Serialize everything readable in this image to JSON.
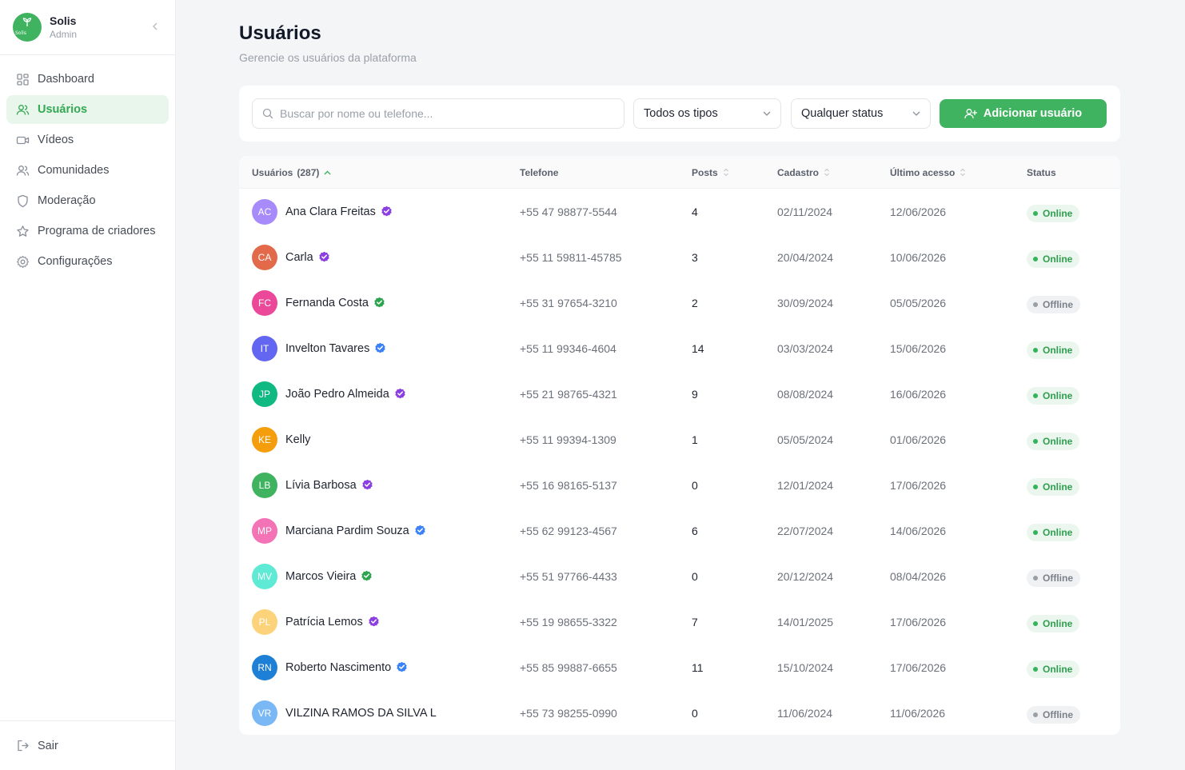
{
  "brand": {
    "name": "Solis",
    "role": "Admin",
    "logo_text": "Solis"
  },
  "nav": [
    {
      "label": "Dashboard",
      "icon": "dashboard-icon",
      "active": false
    },
    {
      "label": "Usuários",
      "icon": "users-icon",
      "active": true
    },
    {
      "label": "Vídeos",
      "icon": "video-icon",
      "active": false
    },
    {
      "label": "Comunidades",
      "icon": "communities-icon",
      "active": false
    },
    {
      "label": "Moderação",
      "icon": "shield-icon",
      "active": false
    },
    {
      "label": "Programa de criadores",
      "icon": "star-icon",
      "active": false
    },
    {
      "label": "Configurações",
      "icon": "gear-icon",
      "active": false
    }
  ],
  "logout": {
    "label": "Sair",
    "icon": "logout-icon"
  },
  "page": {
    "title": "Usuários",
    "subtitle": "Gerencie os usuários da plataforma"
  },
  "toolbar": {
    "search_placeholder": "Buscar por nome ou telefone...",
    "type_filter": "Todos os tipos",
    "status_filter": "Qualquer status",
    "add_label": "Adicionar usuário"
  },
  "table": {
    "headers": {
      "users": "Usuários",
      "users_count": "(287)",
      "phone": "Telefone",
      "posts": "Posts",
      "signup": "Cadastro",
      "last_access": "Último acesso",
      "status": "Status"
    },
    "rows": [
      {
        "initials": "AC",
        "name": "Ana Clara Freitas",
        "color": "#a78bfa",
        "verified": "purple",
        "phone": "+55 47 98877-5544",
        "posts": "4",
        "signup": "02/11/2024",
        "last": "12/06/2026",
        "status": "Online"
      },
      {
        "initials": "CA",
        "name": "Carla",
        "color": "#e2694a",
        "verified": "purple",
        "phone": "+55 11 59811-45785",
        "posts": "3",
        "signup": "20/04/2024",
        "last": "10/06/2026",
        "status": "Online"
      },
      {
        "initials": "FC",
        "name": "Fernanda Costa",
        "color": "#ec4899",
        "verified": "green",
        "phone": "+55 31 97654-3210",
        "posts": "2",
        "signup": "30/09/2024",
        "last": "05/05/2026",
        "status": "Offline"
      },
      {
        "initials": "IT",
        "name": "Invelton Tavares",
        "color": "#6366f1",
        "verified": "blue",
        "phone": "+55 11 99346-4604",
        "posts": "14",
        "signup": "03/03/2024",
        "last": "15/06/2026",
        "status": "Online"
      },
      {
        "initials": "JP",
        "name": "João Pedro Almeida",
        "color": "#10b981",
        "verified": "purple",
        "phone": "+55 21 98765-4321",
        "posts": "9",
        "signup": "08/08/2024",
        "last": "16/06/2026",
        "status": "Online"
      },
      {
        "initials": "KE",
        "name": "Kelly",
        "color": "#f59e0b",
        "verified": "",
        "phone": "+55 11 99394-1309",
        "posts": "1",
        "signup": "05/05/2024",
        "last": "01/06/2026",
        "status": "Online"
      },
      {
        "initials": "LB",
        "name": "Lívia Barbosa",
        "color": "#3fb35f",
        "verified": "purple",
        "phone": "+55 16 98165-5137",
        "posts": "0",
        "signup": "12/01/2024",
        "last": "17/06/2026",
        "status": "Online"
      },
      {
        "initials": "MP",
        "name": "Marciana Pardim Souza",
        "color": "#f472b6",
        "verified": "blue",
        "phone": "+55 62 99123-4567",
        "posts": "6",
        "signup": "22/07/2024",
        "last": "14/06/2026",
        "status": "Online"
      },
      {
        "initials": "MV",
        "name": "Marcos Vieira",
        "color": "#5eead4",
        "verified": "green",
        "phone": "+55 51 97766-4433",
        "posts": "0",
        "signup": "20/12/2024",
        "last": "08/04/2026",
        "status": "Offline"
      },
      {
        "initials": "PL",
        "name": "Patrícia Lemos",
        "color": "#fcd27a",
        "verified": "purple",
        "phone": "+55 19 98655-3322",
        "posts": "7",
        "signup": "14/01/2025",
        "last": "17/06/2026",
        "status": "Online"
      },
      {
        "initials": "RN",
        "name": "Roberto Nascimento",
        "color": "#1d7fd6",
        "verified": "blue",
        "phone": "+55 85 99887-6655",
        "posts": "11",
        "signup": "15/10/2024",
        "last": "17/06/2026",
        "status": "Online"
      },
      {
        "initials": "VR",
        "name": "VILZINA RAMOS DA SILVA L",
        "color": "#7ab8f5",
        "verified": "",
        "phone": "+55 73 98255-0990",
        "posts": "0",
        "signup": "11/06/2024",
        "last": "11/06/2026",
        "status": "Offline"
      }
    ]
  },
  "colors": {
    "accent": "#3fb35f",
    "verified_purple": "#8b3fe0",
    "verified_green": "#2ea44f",
    "verified_blue": "#3b82f6"
  }
}
